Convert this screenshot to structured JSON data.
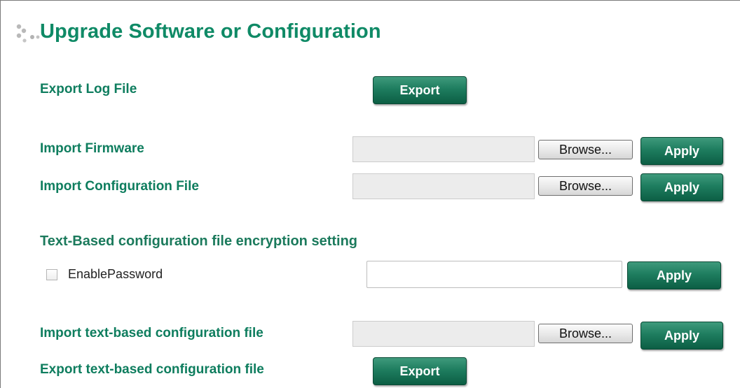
{
  "page": {
    "title": "Upgrade Software or Configuration"
  },
  "export_log": {
    "label": "Export Log File",
    "button": "Export"
  },
  "import_firmware": {
    "label": "Import Firmware",
    "file_value": "",
    "browse": "Browse...",
    "apply": "Apply"
  },
  "import_config": {
    "label": "Import Configuration File",
    "file_value": "",
    "browse": "Browse...",
    "apply": "Apply"
  },
  "encryption": {
    "heading": "Text-Based configuration file encryption setting",
    "checkbox_label": "EnablePassword",
    "checked": false,
    "password_value": "",
    "apply": "Apply"
  },
  "import_text_config": {
    "label": "Import text-based configuration file",
    "file_value": "",
    "browse": "Browse...",
    "apply": "Apply"
  },
  "export_text_config": {
    "label": "Export text-based configuration file",
    "button": "Export"
  },
  "colors": {
    "heading_green": "#0f8a66",
    "button_green": "#1e7d5f"
  },
  "icons": {
    "title_icon": "dotted-bullet-icon"
  }
}
